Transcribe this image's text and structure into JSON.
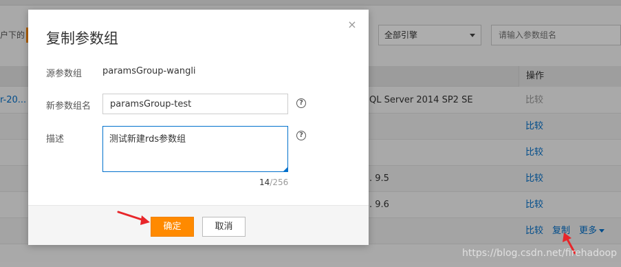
{
  "background": {
    "left_text": "户下的",
    "engine_select": {
      "value": "全部引擎"
    },
    "search": {
      "placeholder": "请输入参数组名"
    },
    "table": {
      "ops_header": "操作",
      "row1_name": "r-20...",
      "row1_version": "QL Server 2014 SP2 SE",
      "row1_compare": "比较",
      "row2_compare": "比较",
      "row3_compare": "比较",
      "row4_version": ". 9.5",
      "row4_compare": "比较",
      "row5_version": ". 9.6",
      "row5_compare": "比较",
      "row6_compare": "比较",
      "row6_copy": "复制",
      "row6_more": "更多"
    }
  },
  "dialog": {
    "title": "复制参数组",
    "close_glyph": "×",
    "source_label": "源参数组",
    "source_value": "paramsGroup-wangli",
    "name_label": "新参数组名",
    "name_value": "paramsGroup-test",
    "desc_label": "描述",
    "desc_value": "测试新建rds参数组",
    "help_glyph": "?",
    "counter_current": "14",
    "counter_max": "/256",
    "confirm_label": "确定",
    "cancel_label": "取消"
  },
  "watermark": "https://blog.csdn.net/firehadoop",
  "colors": {
    "accent": "#ff8a00",
    "link": "#0070cc",
    "annotation_arrow": "#e8262a"
  }
}
